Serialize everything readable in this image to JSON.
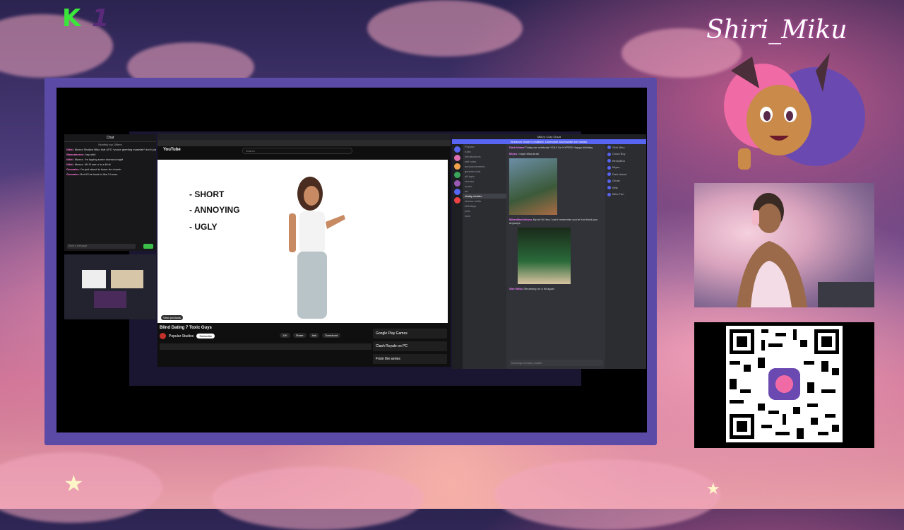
{
  "overlay": {
    "logo_letter": "K",
    "logo_digit": "1",
    "streamer_name": "Shiri_Miku"
  },
  "chat_window": {
    "title": "Chat",
    "subtitle": "Monthly top Gifters",
    "lines": [
      {
        "user": "Nikki",
        "text": "Maxxx Shakira Miko that UFO *youre greeting maselah* don't judge me"
      },
      {
        "user": "Wannabeeee",
        "text": "hey shiri"
      },
      {
        "user": "Nikki",
        "text": "Maxxx: I'm hyping some drama tonight"
      },
      {
        "user": "Nikki",
        "text": "Maxxx: Hi! i'll see u in a lil bit"
      },
      {
        "user": "Gonzalez",
        "text": "I'm just about to leave for church"
      },
      {
        "user": "Gonzalez",
        "text": "But it'll be back in like 2 hours"
      }
    ],
    "input_placeholder": "Send a message"
  },
  "youtube": {
    "logo": "YouTube",
    "search_placeholder": "Search",
    "video_lines": [
      "- SHORT",
      "- ANNOYING",
      "- UGLY"
    ],
    "view_products": "View products",
    "title": "Blind Dating 7 Toxic Guys",
    "channel": "Popular Studios",
    "subscribe": "Subscribe",
    "actions": [
      "11K",
      "Share",
      "Ask",
      "Download"
    ],
    "sidebar": [
      "Google Play Games",
      "Clash Royale on PC",
      "From the series"
    ]
  },
  "discord": {
    "server_title": "Miku's Cozy Cloud",
    "banner": "Streamer Mode is enabled. Username and handle are hidden.",
    "channels": [
      "Popular",
      "rules",
      "introductions",
      "self-roles",
      "announcements",
      "general-chat",
      "off-topic",
      "memes",
      "music",
      "art",
      "chatty-chatter",
      "stream-notifs",
      "birthdays",
      "pets",
      "food"
    ],
    "selected_channel": "chatty-chatter",
    "messages": [
      {
        "user": "Dark Island",
        "text": "Today we celebrate YOU! I'm HYPED! Happy birthday"
      },
      {
        "user": "Mlyss",
        "text": "I hope Miku brah"
      },
      {
        "user": "MikesBackIntoss",
        "text": "My bit Hi Hey I can't remember you're fun thank you anyways"
      },
      {
        "user": "Shiri Miku",
        "text": "Streaming for a bit again"
      }
    ],
    "input_placeholder": "Message #chatty-chatter",
    "members": [
      "Shiri Miku",
      "Cloud Boy",
      "BeckyBoo",
      "Mlyss",
      "Dark Island",
      "Ghost",
      "Kitty",
      "Miko Fan"
    ]
  }
}
